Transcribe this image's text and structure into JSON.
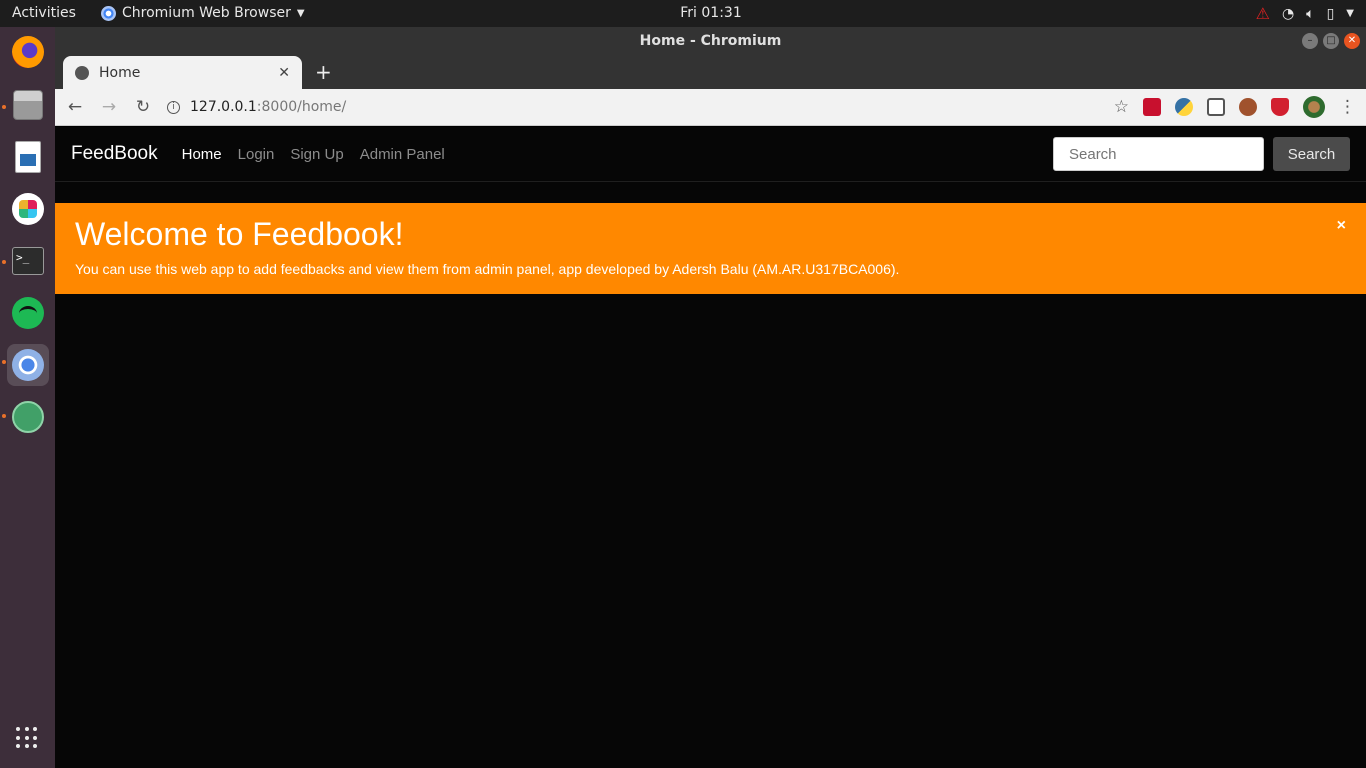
{
  "system": {
    "activities": "Activities",
    "app_name": "Chromium Web Browser",
    "clock": "Fri 01:31"
  },
  "window": {
    "title": "Home - Chromium"
  },
  "tab": {
    "title": "Home"
  },
  "address": {
    "host": "127.0.0.1",
    "path": ":8000/home/"
  },
  "site": {
    "brand": "FeedBook",
    "nav": [
      "Home",
      "Login",
      "Sign Up",
      "Admin Panel"
    ],
    "search_placeholder": "Search",
    "search_button": "Search"
  },
  "alert": {
    "heading": "Welcome to Feedbook!",
    "message": "You can use this web app to add feedbacks and view them from admin panel, app developed by Adersh Balu (AM.AR.U317BCA006).",
    "close": "×",
    "color": "#ff8800"
  }
}
